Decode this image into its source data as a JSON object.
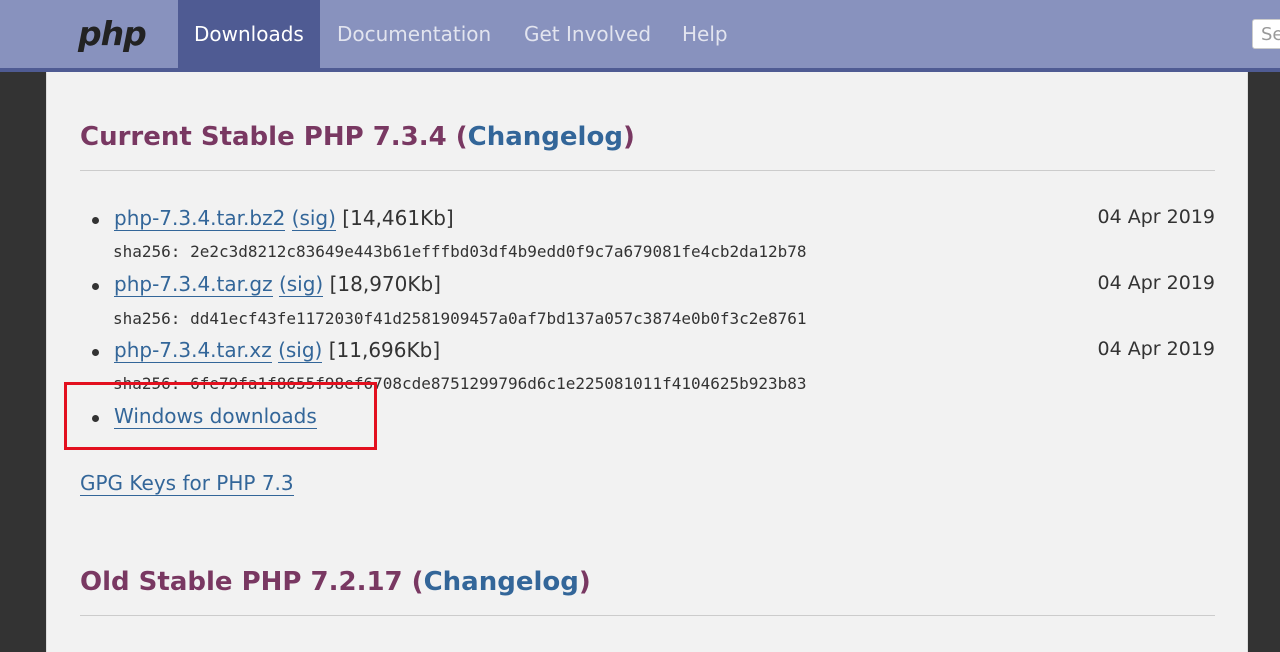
{
  "nav": {
    "logo": "php",
    "items": [
      "Downloads",
      "Documentation",
      "Get Involved",
      "Help"
    ],
    "search_placeholder": "Se"
  },
  "sections": [
    {
      "title_prefix": "Current Stable PHP 7.3.4 (",
      "changelog": "Changelog",
      "title_suffix": ")",
      "downloads": [
        {
          "file": "php-7.3.4.tar.bz2",
          "sig": "(sig)",
          "size": "[14,461Kb]",
          "date": "04 Apr 2019",
          "sha": "sha256: 2e2c3d8212c83649e443b61efffbd03df4b9edd0f9c7a679081fe4cb2da12b78"
        },
        {
          "file": "php-7.3.4.tar.gz",
          "sig": "(sig)",
          "size": "[18,970Kb]",
          "date": "04 Apr 2019",
          "sha": "sha256: dd41ecf43fe1172030f41d2581909457a0af7bd137a057c3874e0b0f3c2e8761"
        },
        {
          "file": "php-7.3.4.tar.xz",
          "sig": "(sig)",
          "size": "[11,696Kb]",
          "date": "04 Apr 2019",
          "sha": "sha256: 6fe79fa1f8655f98ef6708cde8751299796d6c1e225081011f4104625b923b83"
        }
      ],
      "windows": "Windows downloads",
      "gpg": "GPG Keys for PHP 7.3"
    },
    {
      "title_prefix": "Old Stable PHP 7.2.17 (",
      "changelog": "Changelog",
      "title_suffix": ")"
    }
  ],
  "colors": {
    "highlight": "#e3101f",
    "link": "#336699",
    "heading": "#793862"
  }
}
